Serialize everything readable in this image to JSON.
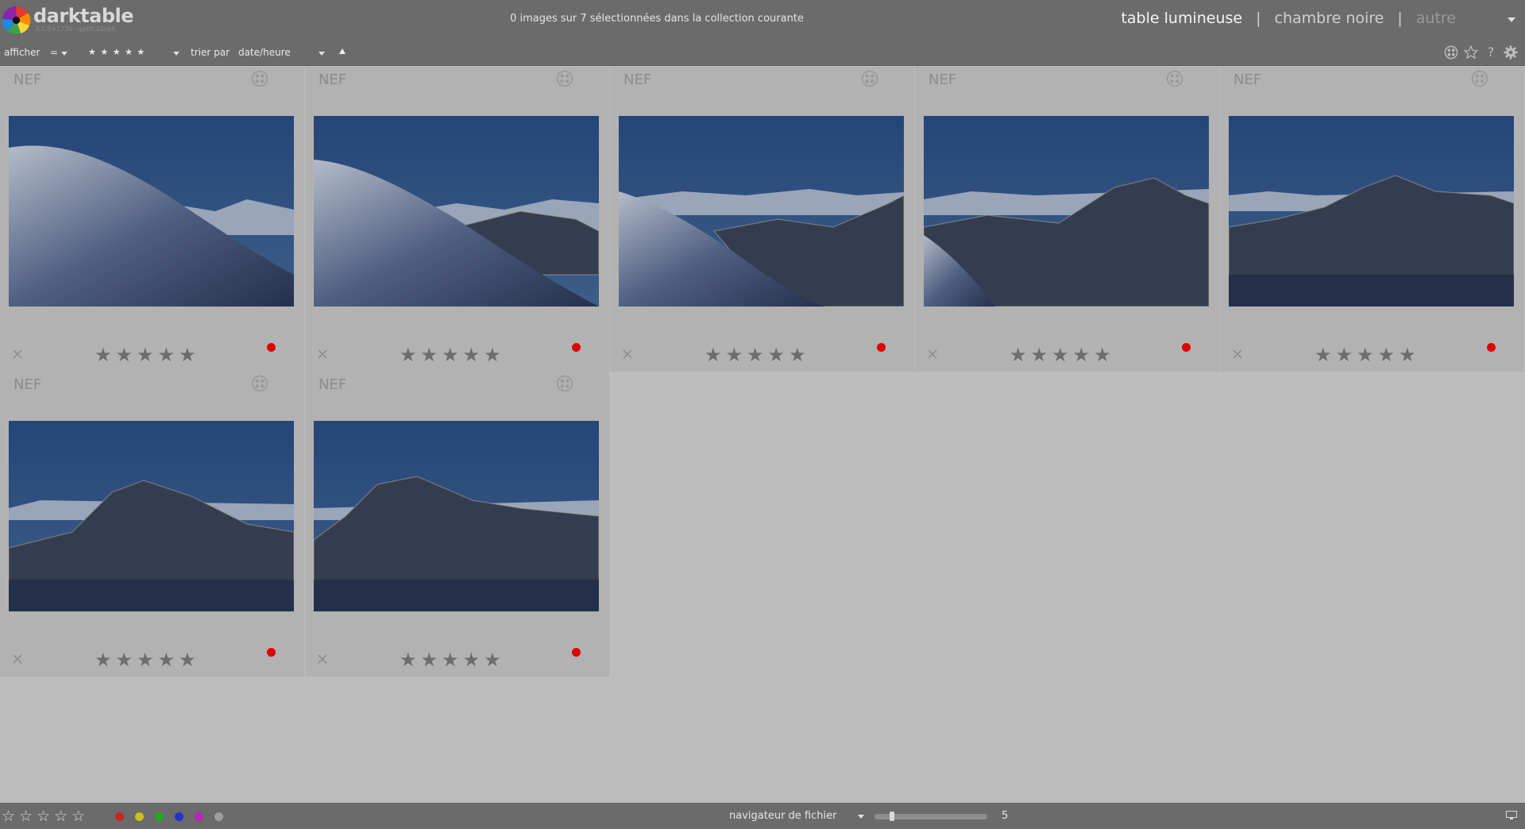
{
  "header": {
    "app_name": "darktable",
    "app_version": "3.1.0+1736~ga6fc3dc68",
    "selection_status": "0 images sur 7 sélectionnées dans la collection courante",
    "views": [
      "table lumineuse",
      "chambre noire",
      "autre"
    ],
    "separator": "|"
  },
  "toolbar": {
    "show_label": "afficher",
    "comparator": "=",
    "rating_filter": "★ ★ ★ ★ ★",
    "sort_label": "trier par",
    "sort_value": "date/heure"
  },
  "thumbnails": [
    {
      "ext": "NEF",
      "stars": "★★★★★",
      "color_label": "#e00000"
    },
    {
      "ext": "NEF",
      "stars": "★★★★★",
      "color_label": "#e00000"
    },
    {
      "ext": "NEF",
      "stars": "★★★★★",
      "color_label": "#e00000"
    },
    {
      "ext": "NEF",
      "stars": "★★★★★",
      "color_label": "#e00000"
    },
    {
      "ext": "NEF",
      "stars": "★★★★★",
      "color_label": "#e00000"
    },
    {
      "ext": "NEF",
      "stars": "★★★★★",
      "color_label": "#e00000"
    },
    {
      "ext": "NEF",
      "stars": "★★★★★",
      "color_label": "#e00000"
    }
  ],
  "bottombar": {
    "stars": "☆☆☆☆☆",
    "color_labels": [
      "#cc2222",
      "#c9c21a",
      "#22aa22",
      "#2233cc",
      "#bb22bb",
      "#9e9e9e"
    ],
    "layout_label": "navigateur de fichier",
    "zoom_value": "5"
  },
  "icons": {
    "grouping": "grouping-icon",
    "overlays": "star-icon",
    "help": "help-icon",
    "preferences": "gear-icon"
  }
}
